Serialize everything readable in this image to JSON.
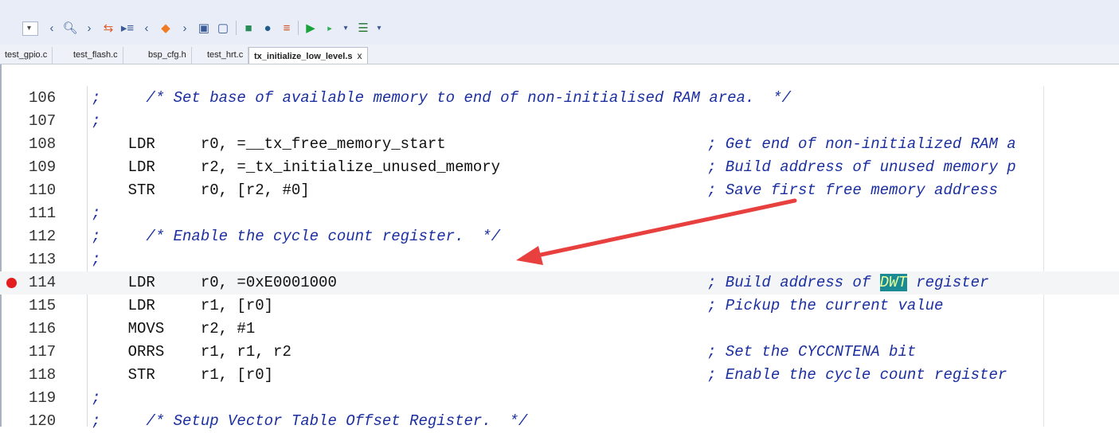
{
  "toolbar": {
    "combo_arrow": "▾",
    "icons": [
      "chevron-left-icon",
      "search-icon",
      "chevron-right-icon",
      "swap-icon",
      "indent-list-icon",
      "chevron-left-icon",
      "bookmark-shield-icon",
      "chevron-right-icon",
      "file-prev-icon",
      "file-next-icon",
      "download-icon",
      "download-dark-icon",
      "list-icon",
      "run-icon",
      "step-icon",
      "overflow-icon",
      "network-icon",
      "overflow-icon"
    ]
  },
  "tabs": [
    {
      "label": "test_gpio.c"
    },
    {
      "label": "test_flash.c"
    },
    {
      "label": "bsp_cfg.h"
    },
    {
      "label": "test_hrt.c"
    },
    {
      "label": "tx_initialize_low_level.s",
      "close": "x",
      "active": true
    }
  ],
  "colors": {
    "breakpoint": "#e41e1e",
    "arrow": "#e8403f",
    "comment": "#1b2fa0",
    "highlight_bg": "#1a8b95"
  },
  "lines": [
    {
      "num": "106",
      "code": ";     /* Set base of available memory to end of non-initialised RAM area.  */",
      "comment": ""
    },
    {
      "num": "107",
      "code": ";",
      "comment": ""
    },
    {
      "num": "108",
      "code": "    LDR     r0, =__tx_free_memory_start",
      "comment": "; Get end of non-initialized RAM a"
    },
    {
      "num": "109",
      "code": "    LDR     r2, =_tx_initialize_unused_memory",
      "comment": "; Build address of unused memory p"
    },
    {
      "num": "110",
      "code": "    STR     r0, [r2, #0]",
      "comment": "; Save first free memory address"
    },
    {
      "num": "111",
      "code": ";",
      "comment": ""
    },
    {
      "num": "112",
      "code": ";     /* Enable the cycle count register.  */",
      "comment": ""
    },
    {
      "num": "113",
      "code": ";",
      "comment": ""
    },
    {
      "num": "114",
      "code": "    LDR     r0, =0xE0001000",
      "comment_pre": "; Build address of ",
      "comment_hl": "DWT",
      "comment_post": " register",
      "breakpoint": true
    },
    {
      "num": "115",
      "code": "    LDR     r1, [r0]",
      "comment": "; Pickup the current value"
    },
    {
      "num": "116",
      "code": "    MOVS    r2, #1",
      "comment": ""
    },
    {
      "num": "117",
      "code": "    ORRS    r1, r1, r2",
      "comment": "; Set the CYCCNTENA bit"
    },
    {
      "num": "118",
      "code": "    STR     r1, [r0]",
      "comment": "; Enable the cycle count register"
    },
    {
      "num": "119",
      "code": ";",
      "comment": ""
    },
    {
      "num": "120",
      "code": ";     /* Setup Vector Table Offset Register.  */",
      "comment": ""
    }
  ]
}
